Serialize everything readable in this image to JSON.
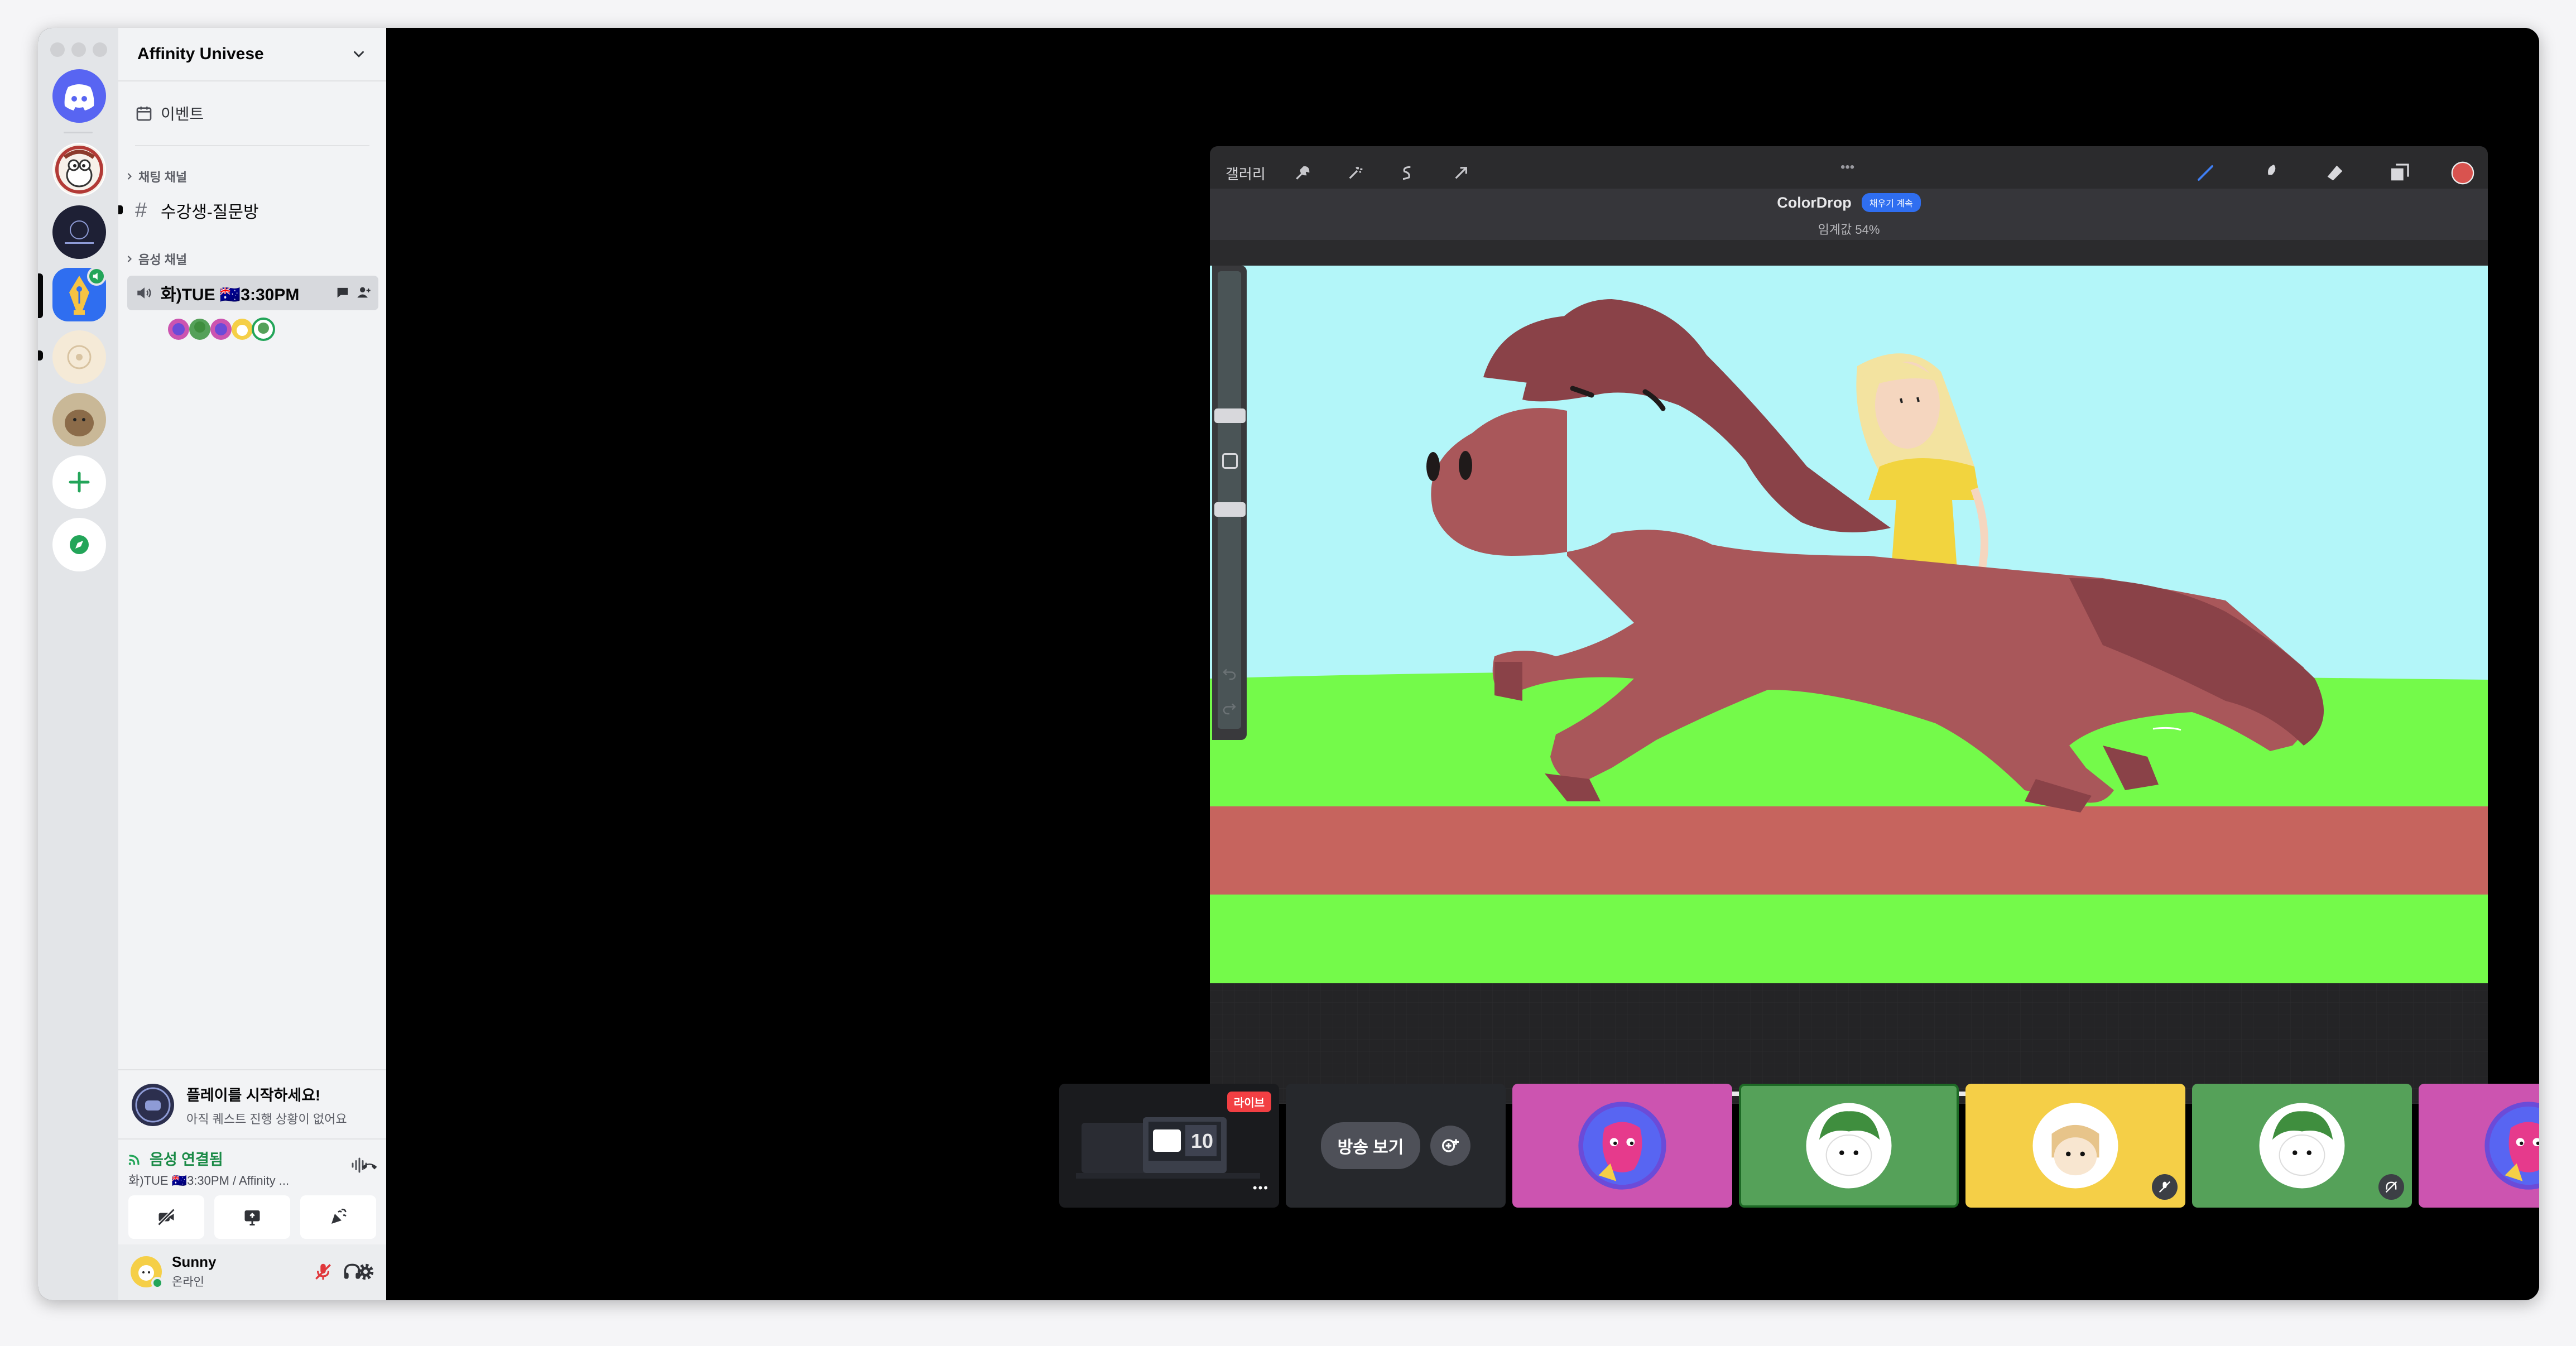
{
  "server": {
    "name": "Affinity Univese"
  },
  "events": {
    "label": "이벤트"
  },
  "categories": {
    "text": "채팅 채널",
    "voice": "음성 채널"
  },
  "text_channel": {
    "name": "수강생-질문방"
  },
  "voice_channel": {
    "name": "화)TUE 🇦🇺3:30PM"
  },
  "activity": {
    "title": "플레이를 시작하세요!",
    "subtitle": "아직 퀘스트 진행 상황이 없어요"
  },
  "voice_status": {
    "title": "음성 연결됨",
    "detail": "화)TUE 🇦🇺3:30PM / Affinity ..."
  },
  "user": {
    "name": "Sunny",
    "status": "온라인"
  },
  "ipad": {
    "gallery_label": "갤러리",
    "app_title": "ColorDrop",
    "app_badge": "채우기 계속",
    "threshold": "임계값 54%",
    "more_glyph": "•••"
  },
  "stream": {
    "live_badge": "라이브",
    "watch_label": "방송 보기",
    "more_glyph": "•••"
  },
  "colors": {
    "sky": "#b3f6f9",
    "grass": "#74fa4a",
    "track": "#c6645e",
    "horse": "#a9575a",
    "mane": "#8a4248",
    "hair": "#f3e3a0",
    "dress": "#f2d43e",
    "tile_pink": "#cc54b0",
    "tile_green": "#55a159",
    "tile_yellow": "#f5cf47",
    "discord": "#5865f2",
    "green_accent": "#23a559",
    "live_red": "#f23f43"
  },
  "icons": {
    "rail": [
      "discord-logo-icon",
      "add-server-icon",
      "explore-icon"
    ],
    "controls": [
      "camera-off-icon",
      "screen-share-icon",
      "activity-rocket-icon",
      "soundboard-icon"
    ],
    "user": [
      "mic-muted-icon",
      "headphones-icon",
      "settings-gear-icon"
    ]
  }
}
